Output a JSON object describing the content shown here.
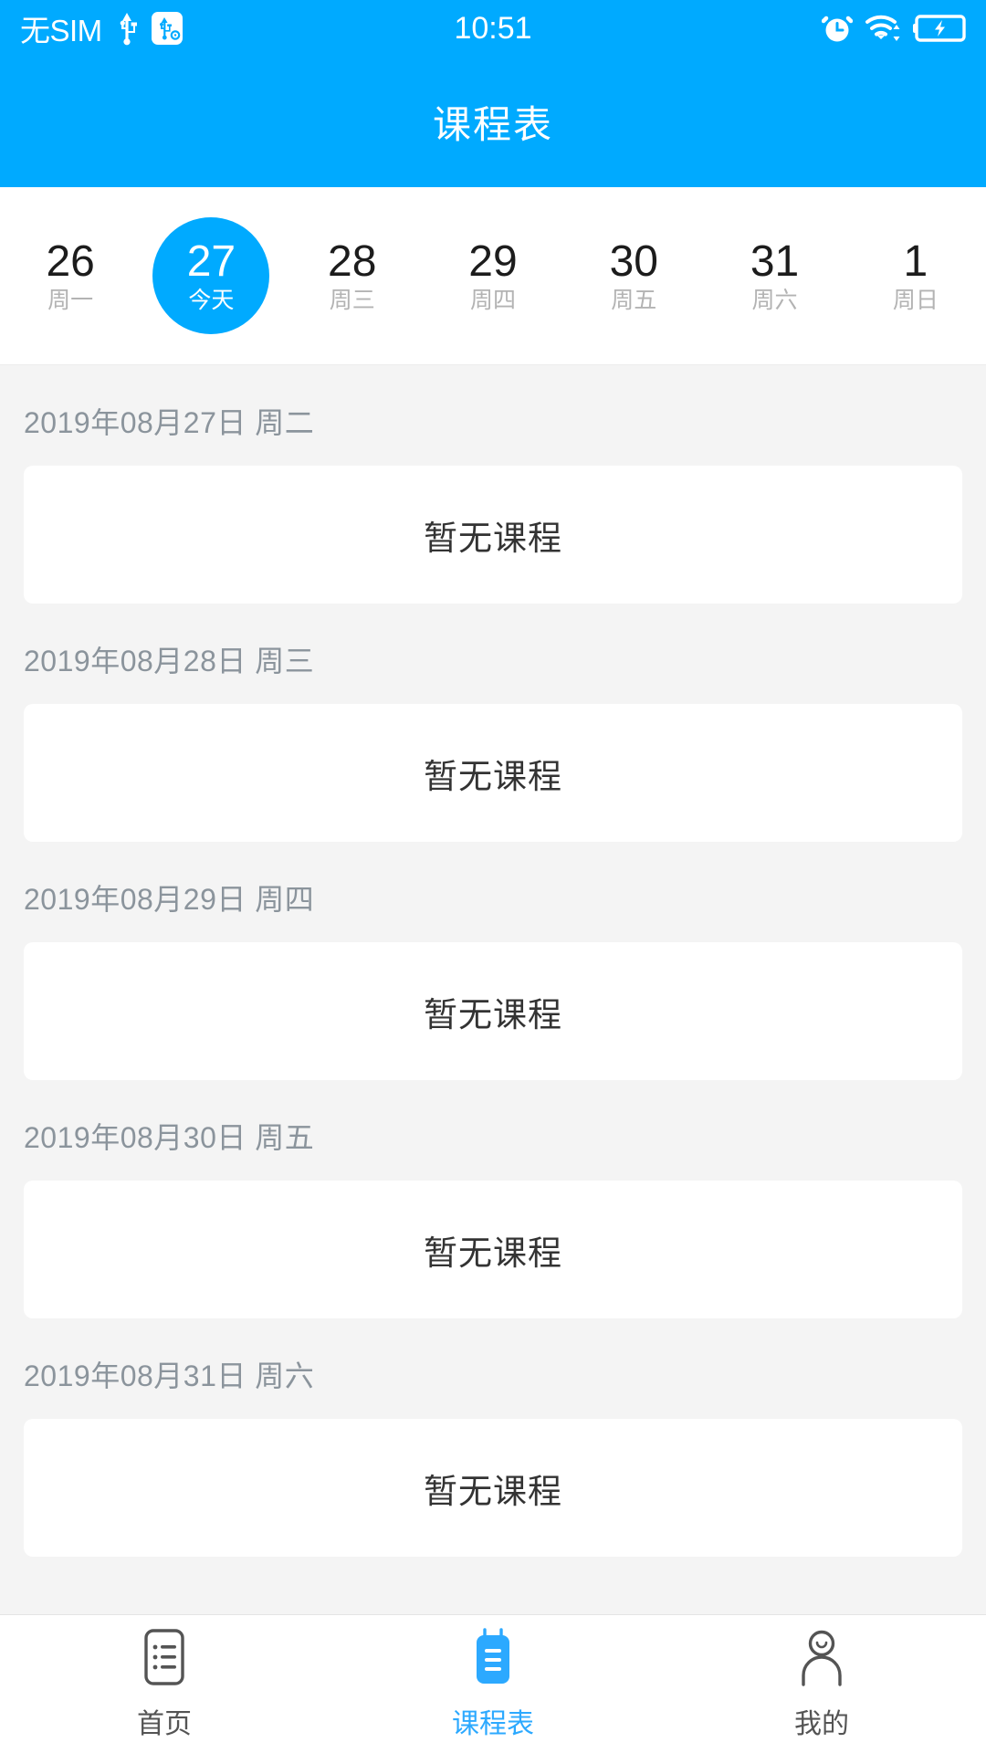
{
  "status_bar": {
    "carrier": "无SIM",
    "time": "10:51",
    "icons_left": [
      "usb-icon",
      "usb-debug-icon"
    ],
    "icons_right": [
      "alarm-clock-icon",
      "wifi-icon",
      "battery-charging-icon"
    ]
  },
  "header": {
    "title": "课程表",
    "background_color": "#00AAFF"
  },
  "week_strip": {
    "days": [
      {
        "number": "26",
        "label": "周一",
        "active": false
      },
      {
        "number": "27",
        "label": "今天",
        "active": true
      },
      {
        "number": "28",
        "label": "周三",
        "active": false
      },
      {
        "number": "29",
        "label": "周四",
        "active": false
      },
      {
        "number": "30",
        "label": "周五",
        "active": false
      },
      {
        "number": "31",
        "label": "周六",
        "active": false
      },
      {
        "number": "1",
        "label": "周日",
        "active": false
      }
    ],
    "active_color": "#00AAFF"
  },
  "schedule": {
    "sections": [
      {
        "date_label": "2019年08月27日 周二",
        "empty_text": "暂无课程"
      },
      {
        "date_label": "2019年08月28日 周三",
        "empty_text": "暂无课程"
      },
      {
        "date_label": "2019年08月29日 周四",
        "empty_text": "暂无课程"
      },
      {
        "date_label": "2019年08月30日 周五",
        "empty_text": "暂无课程"
      },
      {
        "date_label": "2019年08月31日 周六",
        "empty_text": "暂无课程"
      }
    ]
  },
  "tab_bar": {
    "active_color": "#2CA9FF",
    "inactive_color": "#545454",
    "tabs": [
      {
        "label": "首页",
        "icon": "list-document-icon",
        "active": false
      },
      {
        "label": "课程表",
        "icon": "notebook-icon",
        "active": true
      },
      {
        "label": "我的",
        "icon": "person-icon",
        "active": false
      }
    ]
  }
}
